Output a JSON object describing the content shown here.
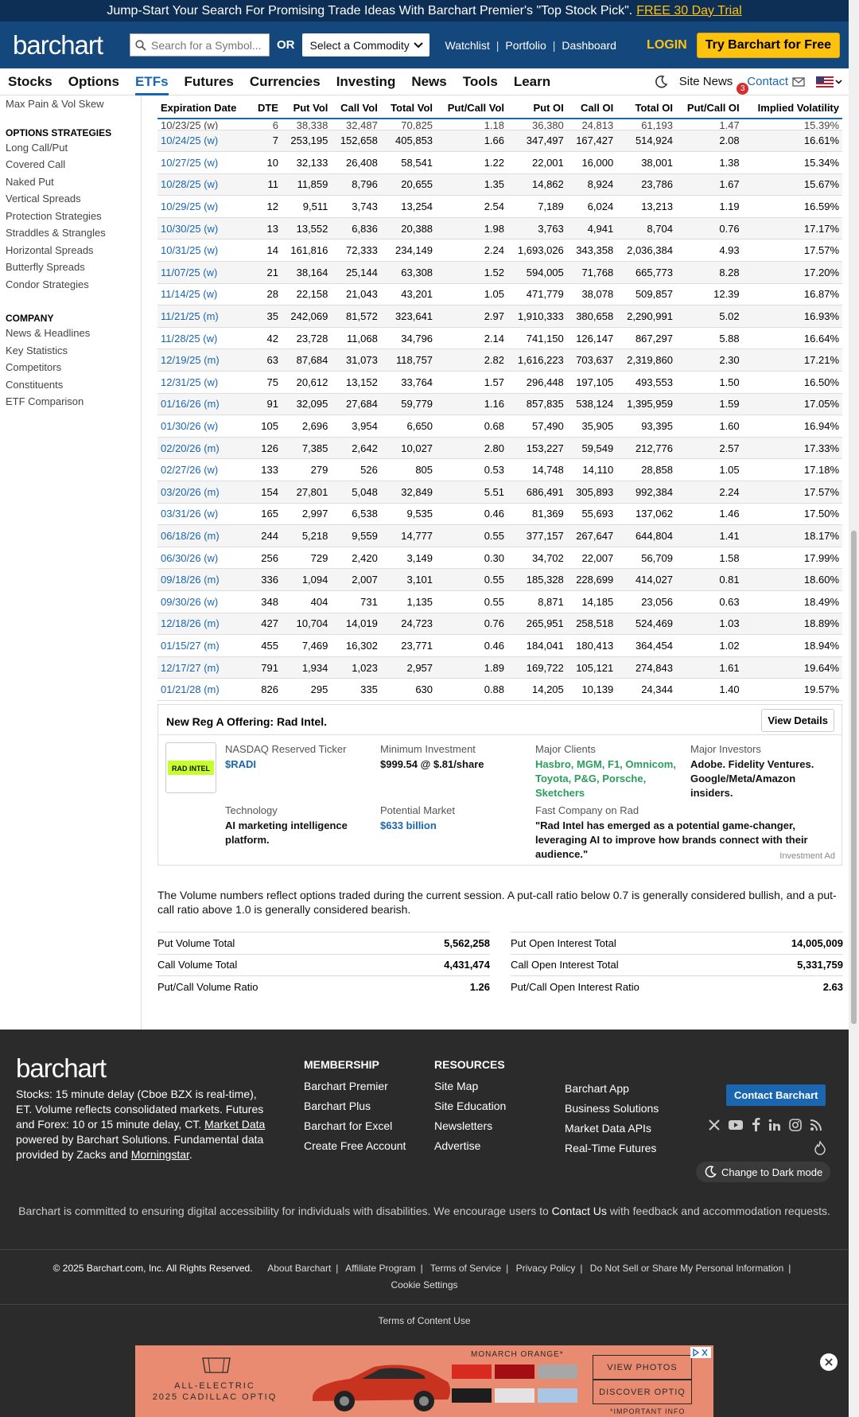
{
  "promo": {
    "text": "Jump-Start Your Search For Promising Trade Ideas With Barchart Premier's \"Top Stock Pick\".",
    "trial": "FREE 30 Day Trial"
  },
  "header": {
    "logo": "barchart",
    "search_placeholder": "Search for a Symbol...",
    "or": "OR",
    "commodity": "Select a Commodity",
    "links": [
      "Watchlist",
      "Portfolio",
      "Dashboard"
    ],
    "login": "LOGIN",
    "try_free": "Try Barchart for Free"
  },
  "nav": {
    "items": [
      "Stocks",
      "Options",
      "ETFs",
      "Futures",
      "Currencies",
      "Investing",
      "News",
      "Tools",
      "Learn"
    ],
    "active": "ETFs",
    "site_news": "Site News",
    "news_count": "3",
    "contact": "Contact"
  },
  "sidebar": {
    "top_link": "Max Pain & Vol Skew",
    "strategies_head": "OPTIONS STRATEGIES",
    "strategies": [
      "Long Call/Put",
      "Covered Call",
      "Naked Put",
      "Vertical Spreads",
      "Protection Strategies",
      "Straddles & Strangles",
      "Horizontal Spreads",
      "Butterfly Spreads",
      "Condor Strategies"
    ],
    "company_head": "COMPANY",
    "company": [
      "News & Headlines",
      "Key Statistics",
      "Competitors",
      "Constituents",
      "ETF Comparison"
    ]
  },
  "table": {
    "headers": [
      "Expiration Date",
      "DTE",
      "Put Vol",
      "Call Vol",
      "Total Vol",
      "Put/Call Vol",
      "Put OI",
      "Call OI",
      "Total OI",
      "Put/Call OI",
      "Implied Volatility"
    ],
    "partial_row": [
      "10/23/25 (w)",
      "6",
      "38,338",
      "32,487",
      "70,825",
      "1.18",
      "36,380",
      "24,813",
      "61,193",
      "1.47",
      "15.39%"
    ],
    "rows": [
      [
        "10/24/25 (w)",
        "7",
        "253,195",
        "152,658",
        "405,853",
        "1.66",
        "347,497",
        "167,427",
        "514,924",
        "2.08",
        "16.61%"
      ],
      [
        "10/27/25 (w)",
        "10",
        "32,133",
        "26,408",
        "58,541",
        "1.22",
        "22,001",
        "16,000",
        "38,001",
        "1.38",
        "15.34%"
      ],
      [
        "10/28/25 (w)",
        "11",
        "11,859",
        "8,796",
        "20,655",
        "1.35",
        "14,862",
        "8,924",
        "23,786",
        "1.67",
        "15.67%"
      ],
      [
        "10/29/25 (w)",
        "12",
        "9,511",
        "3,743",
        "13,254",
        "2.54",
        "7,189",
        "6,024",
        "13,213",
        "1.19",
        "16.59%"
      ],
      [
        "10/30/25 (w)",
        "13",
        "13,552",
        "6,836",
        "20,388",
        "1.98",
        "3,763",
        "4,941",
        "8,704",
        "0.76",
        "17.17%"
      ],
      [
        "10/31/25 (w)",
        "14",
        "161,816",
        "72,333",
        "234,149",
        "2.24",
        "1,693,026",
        "343,358",
        "2,036,384",
        "4.93",
        "17.57%"
      ],
      [
        "11/07/25 (w)",
        "21",
        "38,164",
        "25,144",
        "63,308",
        "1.52",
        "594,005",
        "71,768",
        "665,773",
        "8.28",
        "17.20%"
      ],
      [
        "11/14/25 (w)",
        "28",
        "22,158",
        "21,043",
        "43,201",
        "1.05",
        "471,779",
        "38,078",
        "509,857",
        "12.39",
        "16.87%"
      ],
      [
        "11/21/25 (m)",
        "35",
        "242,069",
        "81,572",
        "323,641",
        "2.97",
        "1,910,333",
        "380,658",
        "2,290,991",
        "5.02",
        "16.93%"
      ],
      [
        "11/28/25 (w)",
        "42",
        "23,728",
        "11,068",
        "34,796",
        "2.14",
        "741,150",
        "126,147",
        "867,297",
        "5.88",
        "16.64%"
      ],
      [
        "12/19/25 (m)",
        "63",
        "87,684",
        "31,073",
        "118,757",
        "2.82",
        "1,616,223",
        "703,637",
        "2,319,860",
        "2.30",
        "17.21%"
      ],
      [
        "12/31/25 (w)",
        "75",
        "20,612",
        "13,152",
        "33,764",
        "1.57",
        "296,448",
        "197,105",
        "493,553",
        "1.50",
        "16.50%"
      ],
      [
        "01/16/26 (m)",
        "91",
        "32,095",
        "27,684",
        "59,779",
        "1.16",
        "857,835",
        "538,124",
        "1,395,959",
        "1.59",
        "17.05%"
      ],
      [
        "01/30/26 (w)",
        "105",
        "2,696",
        "3,954",
        "6,650",
        "0.68",
        "57,490",
        "35,905",
        "93,395",
        "1.60",
        "16.94%"
      ],
      [
        "02/20/26 (m)",
        "126",
        "7,385",
        "2,642",
        "10,027",
        "2.80",
        "153,227",
        "59,549",
        "212,776",
        "2.57",
        "17.33%"
      ],
      [
        "02/27/26 (w)",
        "133",
        "279",
        "526",
        "805",
        "0.53",
        "14,748",
        "14,110",
        "28,858",
        "1.05",
        "17.18%"
      ],
      [
        "03/20/26 (m)",
        "154",
        "27,801",
        "5,048",
        "32,849",
        "5.51",
        "686,491",
        "305,893",
        "992,384",
        "2.24",
        "17.57%"
      ],
      [
        "03/31/26 (w)",
        "165",
        "2,997",
        "6,538",
        "9,535",
        "0.46",
        "81,369",
        "55,693",
        "137,062",
        "1.46",
        "17.50%"
      ],
      [
        "06/18/26 (m)",
        "244",
        "5,218",
        "9,559",
        "14,777",
        "0.55",
        "377,157",
        "267,647",
        "644,804",
        "1.41",
        "18.17%"
      ],
      [
        "06/30/26 (w)",
        "256",
        "729",
        "2,420",
        "3,149",
        "0.30",
        "34,702",
        "22,007",
        "56,709",
        "1.58",
        "17.99%"
      ],
      [
        "09/18/26 (m)",
        "336",
        "1,094",
        "2,007",
        "3,101",
        "0.55",
        "185,328",
        "228,699",
        "414,027",
        "0.81",
        "18.60%"
      ],
      [
        "09/30/26 (w)",
        "348",
        "404",
        "731",
        "1,135",
        "0.55",
        "8,871",
        "14,185",
        "23,056",
        "0.63",
        "18.49%"
      ],
      [
        "12/18/26 (m)",
        "427",
        "10,704",
        "14,019",
        "24,723",
        "0.76",
        "265,951",
        "258,518",
        "524,469",
        "1.03",
        "18.89%"
      ],
      [
        "01/15/27 (m)",
        "455",
        "7,469",
        "16,302",
        "23,771",
        "0.46",
        "184,041",
        "180,413",
        "364,454",
        "1.02",
        "18.94%"
      ],
      [
        "12/17/27 (m)",
        "791",
        "1,934",
        "1,023",
        "2,957",
        "1.89",
        "169,722",
        "105,121",
        "274,843",
        "1.61",
        "19.64%"
      ],
      [
        "01/21/28 (m)",
        "826",
        "295",
        "335",
        "630",
        "0.88",
        "14,205",
        "10,139",
        "24,344",
        "1.40",
        "19.57%"
      ]
    ]
  },
  "ad": {
    "title": "New Reg A Offering: Rad Intel.",
    "view_details": "View Details",
    "logo_text": "RAD INTEL",
    "ticker_label": "NASDAQ Reserved Ticker",
    "ticker": "$RADI",
    "min_label": "Minimum Investment",
    "min": "$999.54 @ $.81/share",
    "clients_label": "Major Clients",
    "clients": "Hasbro, MGM, F1, Omnicom, Toyota, P&G, Porsche, Sketchers",
    "investors_label": "Major Investors",
    "investors": "Adobe. Fidelity Ventures. Google/Meta/Amazon insiders.",
    "tech_label": "Technology",
    "tech": "AI marketing intelligence platform.",
    "market_label": "Potential Market",
    "market": "$633 billion",
    "fc_label": "Fast Company on Rad",
    "fc": "\"Rad Intel has emerged as a potential game-changer, leveraging AI to improve how brands connect with their audience.\"",
    "investment_ad": "Investment Ad"
  },
  "note": "The Volume numbers reflect options traded during the current session. A put-call ratio below 0.7 is generally considered bullish, and a put-call ratio above 1.0 is generally considered bearish.",
  "totals": {
    "left": [
      [
        "Put Volume Total",
        "5,562,258"
      ],
      [
        "Call Volume Total",
        "4,431,474"
      ],
      [
        "Put/Call Volume Ratio",
        "1.26"
      ]
    ],
    "right": [
      [
        "Put Open Interest Total",
        "14,005,009"
      ],
      [
        "Call Open Interest Total",
        "5,331,759"
      ],
      [
        "Put/Call Open Interest Ratio",
        "2.63"
      ]
    ]
  },
  "footer": {
    "logo": "barchart",
    "desc_1": "Stocks: 15 minute delay (Cboe BZX is real-time), ET. Volume reflects consolidated markets. Futures and Forex: 10 or 15 minute delay, CT. ",
    "desc_md": "Market Data",
    "desc_2": " powered by Barchart Solutions. Fundamental data provided by Zacks and ",
    "desc_ms": "Morningstar",
    "desc_3": ".",
    "membership_head": "MEMBERSHIP",
    "membership": [
      "Barchart Premier",
      "Barchart Plus",
      "Barchart for Excel",
      "Create Free Account"
    ],
    "resources_head": "RESOURCES",
    "resources": [
      "Site Map",
      "Site Education",
      "Newsletters",
      "Advertise"
    ],
    "more": [
      "Barchart App",
      "Business Solutions",
      "Market Data APIs",
      "Real-Time Futures"
    ],
    "contact_btn": "Contact Barchart",
    "dark_mode": "Change to Dark mode",
    "access_1": "Barchart is committed to ensuring digital accessibility for individuals with disabilities. We encourage users to ",
    "access_link": "Contact Us",
    "access_2": " with feedback and accommodation requests.",
    "copyright": "© 2025 Barchart.com, Inc. All Rights Reserved.",
    "legal": [
      "About Barchart",
      "Affiliate Program",
      "Terms of Service",
      "Privacy Policy",
      "Do Not Sell or Share My Personal Information",
      "Cookie Settings"
    ],
    "tcu": "Terms of Content Use"
  },
  "banner": {
    "brand": "ALL-ELECTRIC",
    "model": "2025 CADILLAC OPTIQ",
    "color_label": "MONARCH ORANGE*",
    "btn1": "VIEW PHOTOS",
    "btn2": "DISCOVER OPTIQ",
    "important": "*IMPORTANT INFO"
  }
}
